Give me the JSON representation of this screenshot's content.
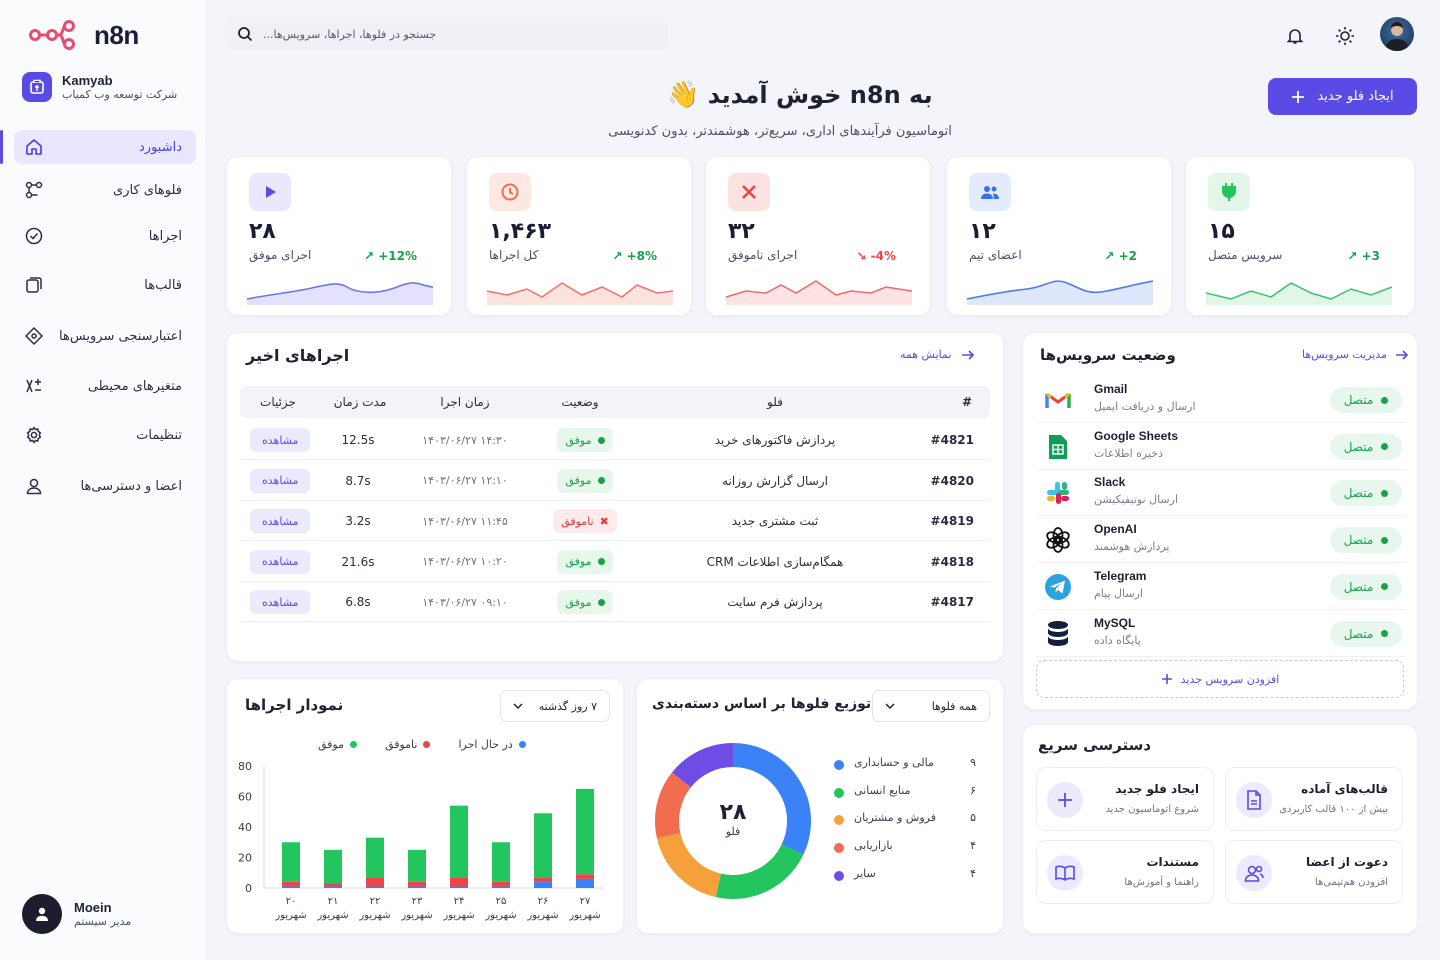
{
  "app": {
    "name": "n8n"
  },
  "workspace": {
    "name": "Kamyab",
    "subtitle": "شرکت توسعه وب کمیاب"
  },
  "nav": [
    {
      "label": "داشبورد",
      "icon": "home-icon",
      "active": true
    },
    {
      "label": "فلوهای کاری",
      "icon": "workflow-icon"
    },
    {
      "label": "اجراها",
      "icon": "executions-icon"
    },
    {
      "label": "قالب‌ها",
      "icon": "templates-icon"
    },
    {
      "label": "اعتبارسنجی سرویس‌ها",
      "icon": "credentials-icon"
    },
    {
      "label": "متغیرهای محیطی",
      "icon": "variables-icon"
    },
    {
      "label": "تنظیمات",
      "icon": "settings-icon"
    },
    {
      "label": "اعضا و دسترسی‌ها",
      "icon": "users-icon"
    }
  ],
  "user": {
    "name": "Moein",
    "role": "مدیر سیستم"
  },
  "search": {
    "placeholder": "جستجو در فلوها، اجراها، سرویس‌ها..."
  },
  "header": {
    "title": "به n8n خوش آمدید",
    "emoji": "👋",
    "subtitle": "اتوماسیون فرآیندهای اداری، سریع‌تر، هوشمندتر، بدون کدنویسی",
    "new_button": "ایجاد فلو جدید"
  },
  "stats": [
    {
      "value": "۲۸",
      "label": "اجرای موفق",
      "change": "+12%",
      "trend": "up",
      "color": "#5b4be6",
      "icon": "play-icon"
    },
    {
      "value": "۱,۴۶۳",
      "label": "کل اجراها",
      "change": "+8%",
      "trend": "up",
      "color": "#f26d4f",
      "icon": "clock-icon"
    },
    {
      "value": "۳۲",
      "label": "اجرای ناموفق",
      "change": "-4%",
      "trend": "down",
      "color": "#ef4444",
      "icon": "x-icon"
    },
    {
      "value": "۱۲",
      "label": "اعضای تیم",
      "change": "+2",
      "trend": "up",
      "color": "#3b6fe6",
      "icon": "team-icon"
    },
    {
      "value": "۱۵",
      "label": "سرویس متصل",
      "change": "+3",
      "trend": "up",
      "color": "#22c55e",
      "icon": "plug-icon"
    }
  ],
  "executions": {
    "title": "اجراهای اخیر",
    "view_all": "نمایش همه",
    "columns": [
      "#",
      "فلو",
      "وضعیت",
      "زمان اجرا",
      "مدت زمان",
      "جزئیات"
    ],
    "rows": [
      {
        "id": "#4821",
        "flow": "پردازش فاکتورهای خرید",
        "status": "موفق",
        "ok": true,
        "time": "۱۴۰۳/۰۶/۲۷ ۱۴:۳۰",
        "duration": "12.5s",
        "action": "مشاهده"
      },
      {
        "id": "#4820",
        "flow": "ارسال گزارش روزانه",
        "status": "موفق",
        "ok": true,
        "time": "۱۴۰۳/۰۶/۲۷ ۱۲:۱۰",
        "duration": "8.7s",
        "action": "مشاهده"
      },
      {
        "id": "#4819",
        "flow": "ثبت مشتری جدید",
        "status": "ناموفق",
        "ok": false,
        "time": "۱۴۰۳/۰۶/۲۷ ۱۱:۴۵",
        "duration": "3.2s",
        "action": "مشاهده"
      },
      {
        "id": "#4818",
        "flow": "همگام‌سازی اطلاعات CRM",
        "status": "موفق",
        "ok": true,
        "time": "۱۴۰۳/۰۶/۲۷ ۱۰:۲۰",
        "duration": "21.6s",
        "action": "مشاهده"
      },
      {
        "id": "#4817",
        "flow": "پردازش فرم سایت",
        "status": "موفق",
        "ok": true,
        "time": "۱۴۰۳/۰۶/۲۷ ۰۹:۱۰",
        "duration": "6.8s",
        "action": "مشاهده"
      }
    ]
  },
  "services": {
    "title": "وضعیت سرویس‌ها",
    "manage": "مدیریت سرویس‌ها",
    "add": "افزودن سرویس جدید",
    "items": [
      {
        "name": "Gmail",
        "desc": "ارسال و دریافت ایمیل",
        "status": "متصل",
        "icon": "gmail-icon"
      },
      {
        "name": "Google Sheets",
        "desc": "ذخیره اطلاعات",
        "status": "متصل",
        "icon": "sheets-icon"
      },
      {
        "name": "Slack",
        "desc": "ارسال نوتیفیکیشن",
        "status": "متصل",
        "icon": "slack-icon"
      },
      {
        "name": "OpenAI",
        "desc": "پردازش هوشمند",
        "status": "متصل",
        "icon": "openai-icon"
      },
      {
        "name": "Telegram",
        "desc": "ارسال پیام",
        "status": "متصل",
        "icon": "telegram-icon"
      },
      {
        "name": "MySQL",
        "desc": "پایگاه داده",
        "status": "متصل",
        "icon": "database-icon"
      }
    ]
  },
  "exec_chart": {
    "title": "نمودار اجراها",
    "range": "۷ روز گذشته",
    "legend": [
      "موفق",
      "ناموفق",
      "در حال اجرا"
    ]
  },
  "chart_data": [
    {
      "type": "bar",
      "title": "نمودار اجراها",
      "categories": [
        "۲۰ شهریور",
        "۲۱ شهریور",
        "۲۲ شهریور",
        "۲۳ شهریور",
        "۲۴ شهریور",
        "۲۵ شهریور",
        "۲۶ شهریور",
        "۲۷ شهریور"
      ],
      "series": [
        {
          "name": "موفق",
          "color": "#22c55e",
          "values": [
            26,
            22,
            26,
            21,
            47,
            26,
            42,
            56
          ]
        },
        {
          "name": "ناموفق",
          "color": "#ef4444",
          "values": [
            3,
            2,
            6,
            3,
            6,
            3,
            3,
            3
          ]
        },
        {
          "name": "در حال اجرا",
          "color": "#3b82f6",
          "values": [
            1,
            1,
            1,
            1,
            1,
            1,
            4,
            6
          ]
        }
      ],
      "ylim": [
        0,
        80
      ],
      "yticks": [
        0,
        20,
        40,
        60,
        80
      ],
      "stacked": true
    },
    {
      "type": "pie",
      "title": "توزیع فلوها بر اساس دسته‌بندی",
      "filter": "همه فلوها",
      "center_value": "۲۸",
      "center_label": "فلو",
      "slices": [
        {
          "label": "مالی و حسابداری",
          "value": 9,
          "display": "۹",
          "color": "#3b82f6"
        },
        {
          "label": "منابع انسانی",
          "value": 6,
          "display": "۶",
          "color": "#22c55e"
        },
        {
          "label": "فروش و مشتریان",
          "value": 5,
          "display": "۵",
          "color": "#f5a03a"
        },
        {
          "label": "بازاریابی",
          "value": 4,
          "display": "۴",
          "color": "#f26d4f"
        },
        {
          "label": "سایر",
          "value": 4,
          "display": "۴",
          "color": "#6d4de6"
        }
      ]
    }
  ],
  "quick": {
    "title": "دسترسی سریع",
    "items": [
      {
        "title": "ایجاد فلو جدید",
        "desc": "شروع اتوماسیون جدید",
        "icon": "plus-icon"
      },
      {
        "title": "قالب‌های آماده",
        "desc": "بیش از ۱۰۰ قالب کاربردی",
        "icon": "template-icon"
      },
      {
        "title": "مستندات",
        "desc": "راهنما و آموزش‌ها",
        "icon": "book-icon"
      },
      {
        "title": "دعوت از اعضا",
        "desc": "افزودن هم‌تیمی‌ها",
        "icon": "invite-icon"
      }
    ]
  }
}
